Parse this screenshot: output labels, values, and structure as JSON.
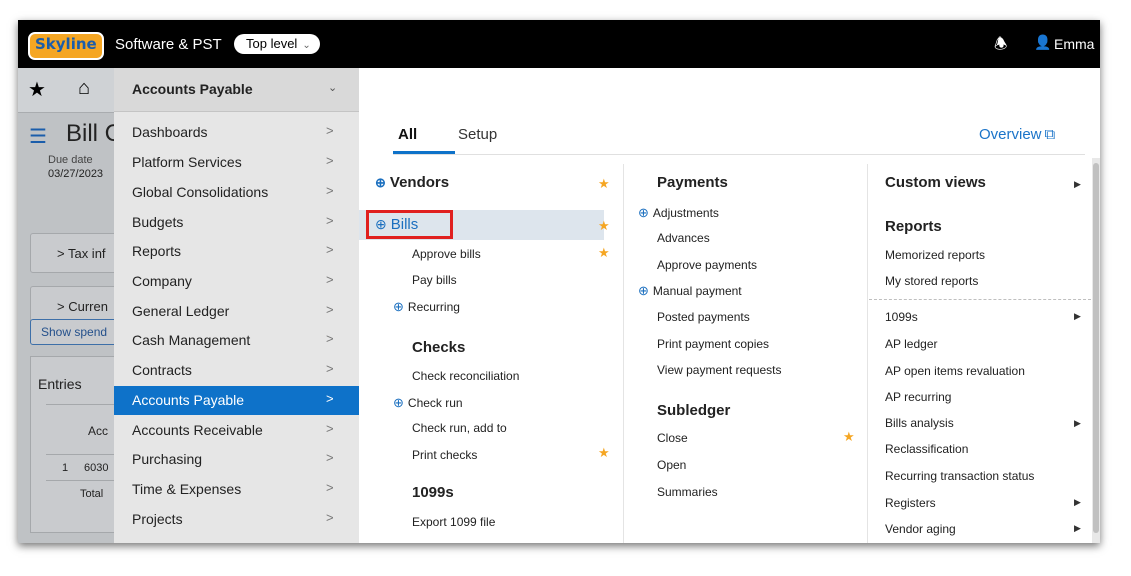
{
  "topbar": {
    "logo": "Skyline",
    "company": "Software & PST",
    "scope": "Top level",
    "scope_chevron": "⌄",
    "user": "Emma"
  },
  "background": {
    "page_title": "Bill C",
    "due_date_label": "Due date",
    "due_date_value": "03/27/2023",
    "tax_card": "> Tax inf",
    "currency_card": "> Curren",
    "show_spend_button": "Show spend",
    "entries_title": "Entries",
    "table_header": "Acc",
    "row1_num": "1",
    "row1_acc": "6030",
    "total_label": "Total"
  },
  "menu": {
    "current": "Accounts Payable",
    "items": [
      {
        "label": "Dashboards",
        "active": false
      },
      {
        "label": "Platform Services",
        "active": false
      },
      {
        "label": "Global Consolidations",
        "active": false
      },
      {
        "label": "Budgets",
        "active": false
      },
      {
        "label": "Reports",
        "active": false
      },
      {
        "label": "Company",
        "active": false
      },
      {
        "label": "General Ledger",
        "active": false
      },
      {
        "label": "Cash Management",
        "active": false
      },
      {
        "label": "Contracts",
        "active": false
      },
      {
        "label": "Accounts Payable",
        "active": true
      },
      {
        "label": "Accounts Receivable",
        "active": false
      },
      {
        "label": "Purchasing",
        "active": false
      },
      {
        "label": "Time & Expenses",
        "active": false
      },
      {
        "label": "Projects",
        "active": false
      }
    ]
  },
  "panel": {
    "tabs": [
      "All",
      "Setup"
    ],
    "overview": "Overview",
    "col1": {
      "vendors": "Vendors",
      "bills": "Bills",
      "approve_bills": "Approve bills",
      "pay_bills": "Pay bills",
      "recurring": "Recurring",
      "checks": "Checks",
      "check_reconciliation": "Check reconciliation",
      "check_run": "Check run",
      "check_run_add": "Check run, add to",
      "print_checks": "Print checks",
      "section_1099": "1099s",
      "export_1099": "Export 1099 file"
    },
    "col2": {
      "payments": "Payments",
      "adjustments": "Adjustments",
      "advances": "Advances",
      "approve_payments": "Approve payments",
      "manual_payment": "Manual payment",
      "posted_payments": "Posted payments",
      "print_payment_copies": "Print payment copies",
      "view_payment_requests": "View payment requests",
      "subledger": "Subledger",
      "close": "Close",
      "open": "Open",
      "summaries": "Summaries"
    },
    "col3": {
      "custom_views": "Custom views",
      "reports": "Reports",
      "memorized_reports": "Memorized reports",
      "my_stored_reports": "My stored reports",
      "r1099s": "1099s",
      "ap_ledger": "AP ledger",
      "ap_open_items": "AP open items revaluation",
      "ap_recurring": "AP recurring",
      "bills_analysis": "Bills analysis",
      "reclassification": "Reclassification",
      "recurring_status": "Recurring transaction status",
      "registers": "Registers",
      "vendor_aging": "Vendor aging"
    }
  }
}
